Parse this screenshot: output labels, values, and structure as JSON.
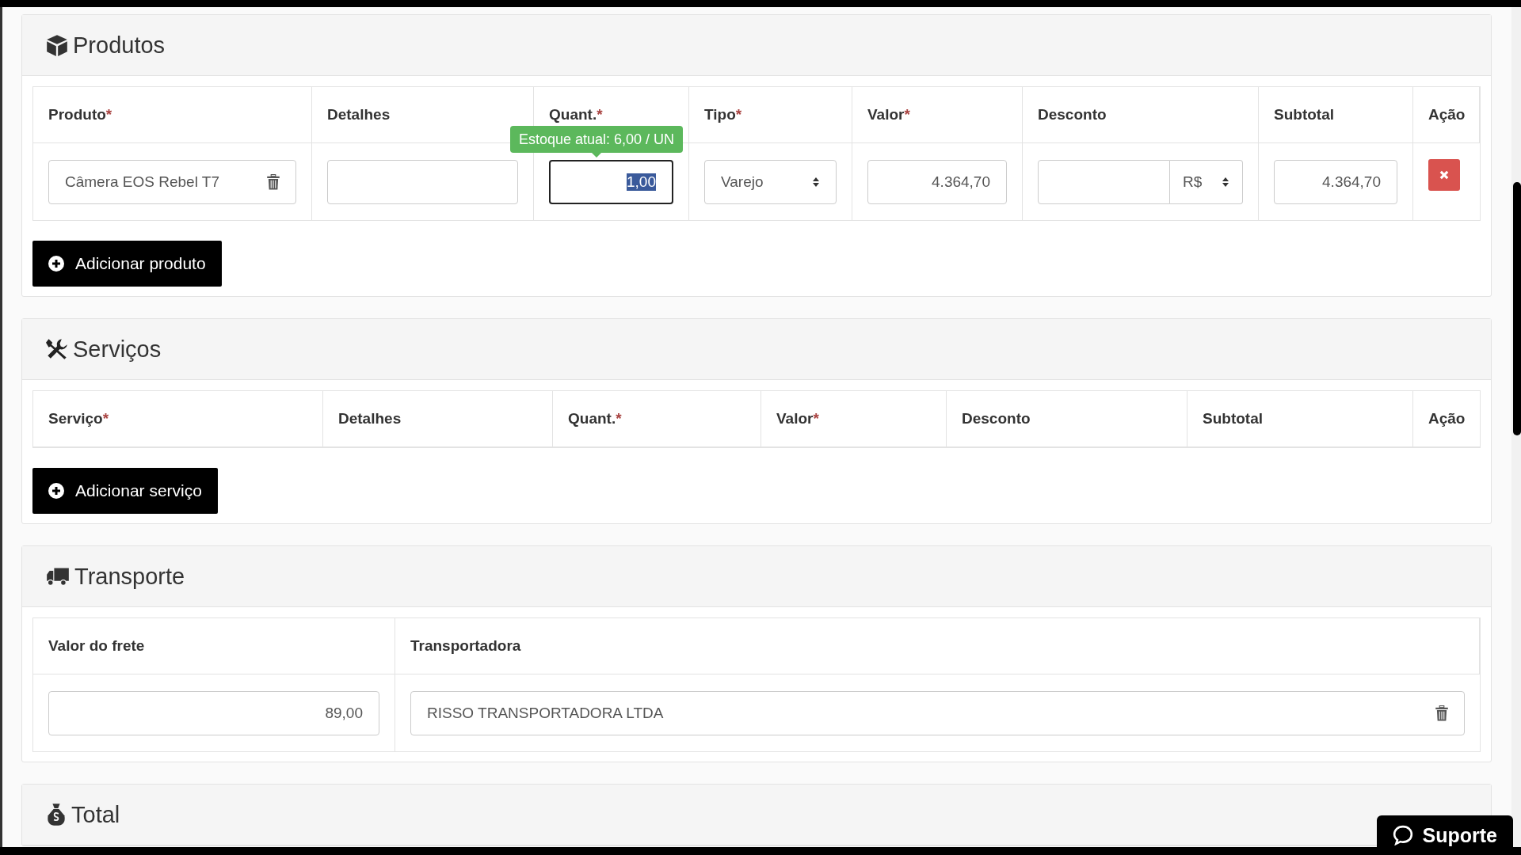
{
  "sections": [
    {
      "kind": "products",
      "title": "Produtos",
      "columns": [
        {
          "label": "Produto",
          "mark": "*"
        },
        {
          "label": "Detalhes"
        },
        {
          "label": "Quant.",
          "mark": "*"
        },
        {
          "label": "Tipo",
          "mark": "*"
        },
        {
          "label": "Valor",
          "mark": "*"
        },
        {
          "label": "Desconto"
        },
        {
          "label": "Subtotal"
        },
        {
          "label": "Ação"
        }
      ],
      "rows": [
        {
          "cells": [
            {
              "kind": "lookup",
              "value": "Câmera EOS Rebel T7"
            },
            {
              "kind": "text"
            },
            {
              "kind": "number",
              "value": "1,00",
              "focused": true,
              "tooltip": "Estoque atual: 6,00 / UN"
            },
            {
              "kind": "select",
              "value": "Varejo"
            },
            {
              "kind": "number",
              "value": "4.364,70"
            },
            {
              "kind": "discount",
              "unit": "R$"
            },
            {
              "kind": "number",
              "value": "4.364,70"
            },
            {
              "kind": "delete"
            }
          ]
        }
      ],
      "button": "Adicionar produto"
    },
    {
      "kind": "services",
      "title": "Serviços",
      "columns": [
        {
          "label": "Serviço",
          "mark": "*"
        },
        {
          "label": "Detalhes"
        },
        {
          "label": "Quant.",
          "mark": "*"
        },
        {
          "label": "Valor",
          "mark": "*"
        },
        {
          "label": "Desconto"
        },
        {
          "label": "Subtotal"
        },
        {
          "label": "Ação"
        }
      ],
      "button": "Adicionar serviço"
    },
    {
      "kind": "transport",
      "title": "Transporte",
      "columns": [
        {
          "label": "Valor do frete"
        },
        {
          "label": "Transportadora"
        }
      ],
      "rows": [
        {
          "cells": [
            {
              "kind": "number",
              "value": "89,00"
            },
            {
              "kind": "lookup",
              "value": "RISSO TRANSPORTADORA LTDA"
            }
          ]
        }
      ]
    },
    {
      "kind": "total",
      "title": "Total"
    }
  ],
  "support_button": "Suporte"
}
